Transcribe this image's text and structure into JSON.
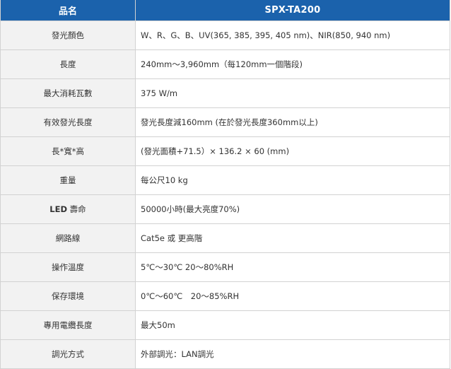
{
  "header": {
    "label": "品名",
    "value": "SPX-TA200"
  },
  "rows": [
    {
      "label": "發光顏色",
      "value": "W、R、G、B、UV(365, 385, 395, 405 nm)、NIR(850, 940 nm)"
    },
    {
      "label": "長度",
      "value": "240mm～3,960mm（每120mm一個階段)"
    },
    {
      "label": "最大消耗瓦數",
      "value": "375 W/m"
    },
    {
      "label": "有效發光長度",
      "value": " 發光長度減160mm (在於發光長度360mm以上)"
    },
    {
      "label": "長*寬*高",
      "value": "(發光面積+71.5）× 136.2 × 60 (mm)"
    },
    {
      "label": "重量",
      "value": "每公尺10 kg"
    },
    {
      "label_prefix": "LED",
      "label": " 壽命",
      "value": "50000小時(最大亮度70%)"
    },
    {
      "label": "網路線",
      "value": "Cat5e 或 更高階"
    },
    {
      "label": "操作溫度",
      "value": "5℃～30℃ 20～80%RH"
    },
    {
      "label": "保存環境",
      "value": "0℃～60℃　20～85%RH"
    },
    {
      "label": "專用電纜長度",
      "value": "最大50m"
    },
    {
      "label": "調光方式",
      "value": "外部調光：LAN調光"
    }
  ]
}
